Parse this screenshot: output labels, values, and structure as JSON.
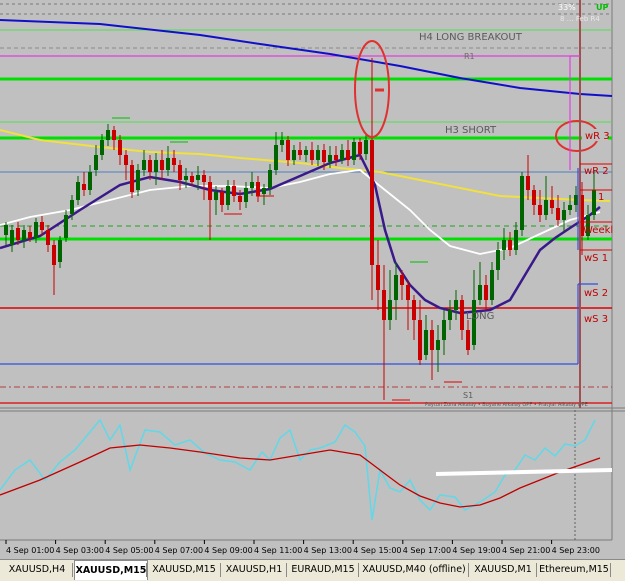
{
  "chart": {
    "corner_pct": "33%",
    "corner_up": "UP",
    "corner_sub": "8 … Feb R4",
    "labels": {
      "h4_long_breakout": "H4 LONG BREAKOUT",
      "r1": "R1",
      "h3_short": "H3 SHORT",
      "long": "LONG",
      "s1": "S1",
      "copyright": "Paytun Zona Alkalay • Buyane Alkalay OPF • Pratyar Alkalay OPE"
    },
    "levels": {
      "wR3": "wR 3",
      "wR2": "wR 2",
      "wR1": "1",
      "weekly": "Weekl",
      "wS1": "wS 1",
      "wS2": "wS 2",
      "wS3": "wS 3"
    },
    "colors": {
      "background": "#c0c0c0",
      "bull_candle": "#006400",
      "bear_candle": "#c80000",
      "ma_purple": "#3a1a8a",
      "ma_white": "#ffffff",
      "ma_yellow": "#f0e040",
      "ma_blue": "#1010c8",
      "level_green": "#00e000",
      "level_red": "#e00000",
      "annotation_red": "#e03030",
      "oscillator_cyan": "#60d8e8",
      "oscillator_red": "#c00000"
    }
  },
  "time_axis": [
    "4 Sep 01:00",
    "4 Sep 03:00",
    "4 Sep 05:00",
    "4 Sep 07:00",
    "4 Sep 09:00",
    "4 Sep 11:00",
    "4 Sep 13:00",
    "4 Sep 15:00",
    "4 Sep 17:00",
    "4 Sep 19:00",
    "4 Sep 21:00",
    "4 Sep 23:00"
  ],
  "tabs": [
    {
      "label": "XAUUSD,H4",
      "active": false
    },
    {
      "label": "XAUUSD,M15",
      "active": true
    },
    {
      "label": "XAUUSD,M15",
      "active": false
    },
    {
      "label": "XAUUSD,H1",
      "active": false
    },
    {
      "label": "EURAUD,M15",
      "active": false
    },
    {
      "label": "XAUUSD,M40 (offline)",
      "active": false
    },
    {
      "label": "XAUUSD,M1",
      "active": false
    },
    {
      "label": "Ethereum,M15",
      "active": false
    }
  ]
}
